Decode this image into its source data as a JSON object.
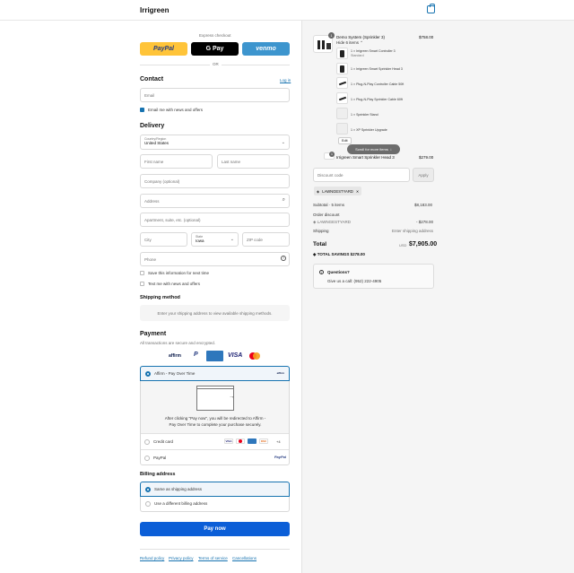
{
  "header": {
    "brand": "Irrigreen"
  },
  "express": {
    "label": "Express checkout",
    "paypal": "PayPal",
    "gpay": "G Pay",
    "venmo": "venmo",
    "or": "OR"
  },
  "contact": {
    "title": "Contact",
    "login": "Log in",
    "email_placeholder": "Email",
    "news_label": "Email me with news and offers"
  },
  "delivery": {
    "title": "Delivery",
    "country_label": "Country/Region",
    "country_value": "United States",
    "first_name": "First name",
    "last_name": "Last name",
    "company": "Company (optional)",
    "address": "Address",
    "apartment": "Apartment, suite, etc. (optional)",
    "city": "City",
    "state_label": "State",
    "state_value": "Iowa",
    "zip": "ZIP code",
    "phone": "Phone",
    "save_info": "Save this information for next time",
    "text_me": "Text me with news and offers"
  },
  "shipping": {
    "title": "Shipping method",
    "note": "Enter your shipping address to view available shipping methods."
  },
  "payment": {
    "title": "Payment",
    "subtitle": "All transactions are secure and encrypted.",
    "affirm_option": "Affirm - Pay Over Time",
    "affirm_note": "After clicking \"Pay now\", you will be redirected to Affirm - Pay Over Time to complete your purchase securely.",
    "credit_card": "Credit card",
    "paypal": "PayPal",
    "affirm_logo": "affirm",
    "card_more": "+4"
  },
  "billing": {
    "title": "Billing address",
    "same": "Same as shipping address",
    "different": "Use a different billing address"
  },
  "pay_now": "Pay now",
  "footer_links": [
    "Refund policy",
    "Privacy policy",
    "Terms of service",
    "Cancellations"
  ],
  "order": {
    "main_item": {
      "name": "Demo System (Sprinkler 3)",
      "price": "$758.00",
      "qty": "1",
      "hide_label": "Hide 6 items"
    },
    "sub_items": [
      {
        "label": "1 × Irrigreen Smart Controller 3",
        "variant": "Standard"
      },
      {
        "label": "1 × Irrigreen Smart Sprinkler Head 3"
      },
      {
        "label": "1 × Plug-N-Play Controller Cable 50ft"
      },
      {
        "label": "1 × Plug-N-Play Sprinkler Cable 60ft"
      },
      {
        "label": "1 × Sprinkler Stand"
      },
      {
        "label": "1 × XP Sprinkler Upgrade"
      }
    ],
    "edit": "Edit",
    "scroll_hint": "Scroll for more items",
    "second_item": {
      "name": "Irrigreen Smart Sprinkler Head 3",
      "price": "$279.00",
      "qty": "1"
    },
    "discount_placeholder": "Discount code",
    "apply": "Apply",
    "code_tag": "LAWNGESTYARD",
    "subtotal_label": "Subtotal · 5 items",
    "subtotal_value": "$8,183.00",
    "order_discount_label": "Order discount",
    "discount_code_label": "LAWNGESTYARD",
    "discount_value": "- $278.00",
    "shipping_label": "Shipping",
    "shipping_value": "Enter shipping address",
    "total_label": "Total",
    "currency": "USD",
    "total_value": "$7,905.00",
    "savings_label": "TOTAL SAVINGS",
    "savings_value": "$278.00",
    "questions_title": "Questions?",
    "questions_text": "Give us a call: (952) 222-4905"
  },
  "colors": {
    "accent": "#1773b0",
    "paypal_yellow": "#ffc439",
    "venmo_blue": "#3d95ce",
    "pay_button": "#0b5ed7"
  }
}
